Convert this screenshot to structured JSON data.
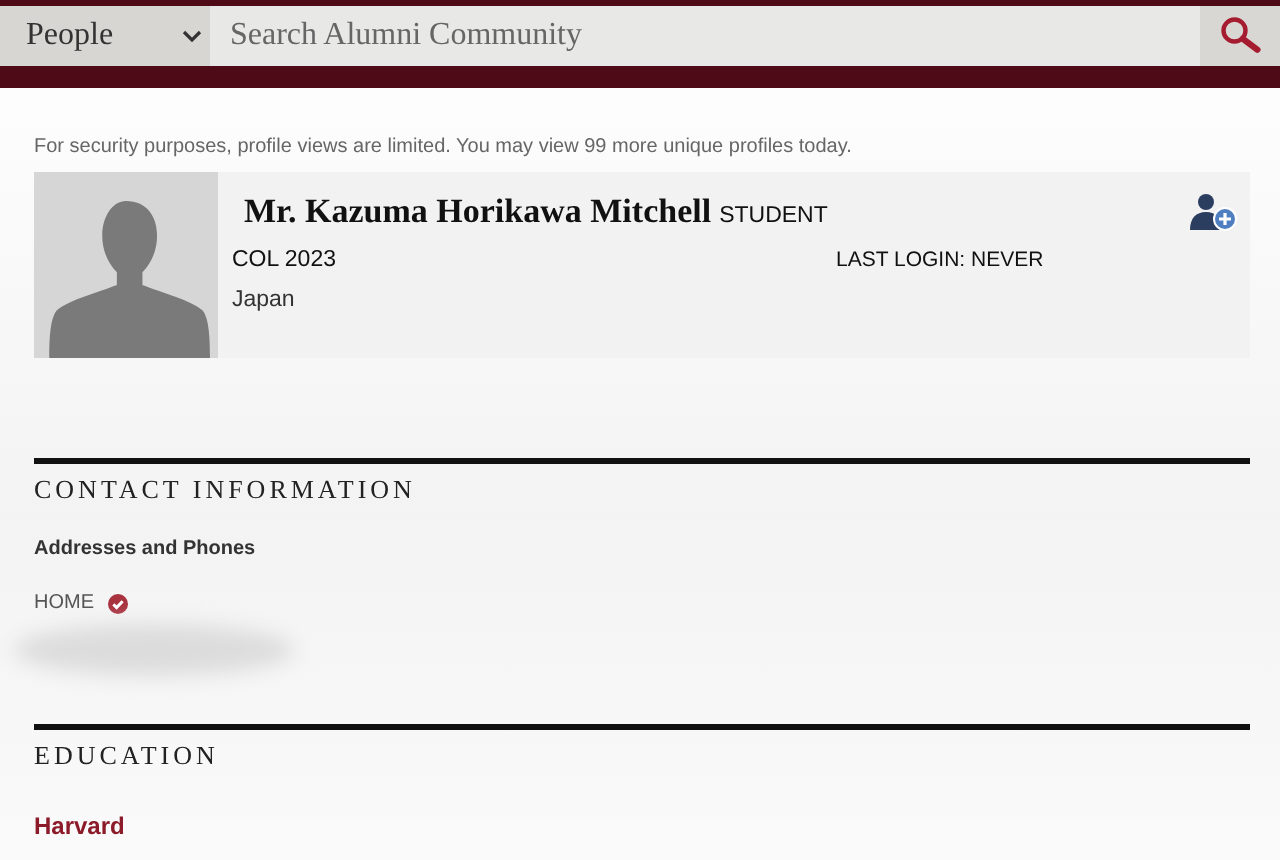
{
  "search_bar": {
    "scope": "People",
    "placeholder": "Search Alumni Community"
  },
  "notice": "For security purposes, profile views are limited. You may view 99 more unique profiles today.",
  "profile": {
    "name": "Mr. Kazuma Horikawa Mitchell",
    "role": "STUDENT",
    "class_year": "COL 2023",
    "last_login": "LAST LOGIN: NEVER",
    "location": "Japan"
  },
  "contact": {
    "heading": "CONTACT INFORMATION",
    "subheading": "Addresses and Phones",
    "address_label": "HOME"
  },
  "education": {
    "heading": "EDUCATION",
    "school": "Harvard"
  }
}
